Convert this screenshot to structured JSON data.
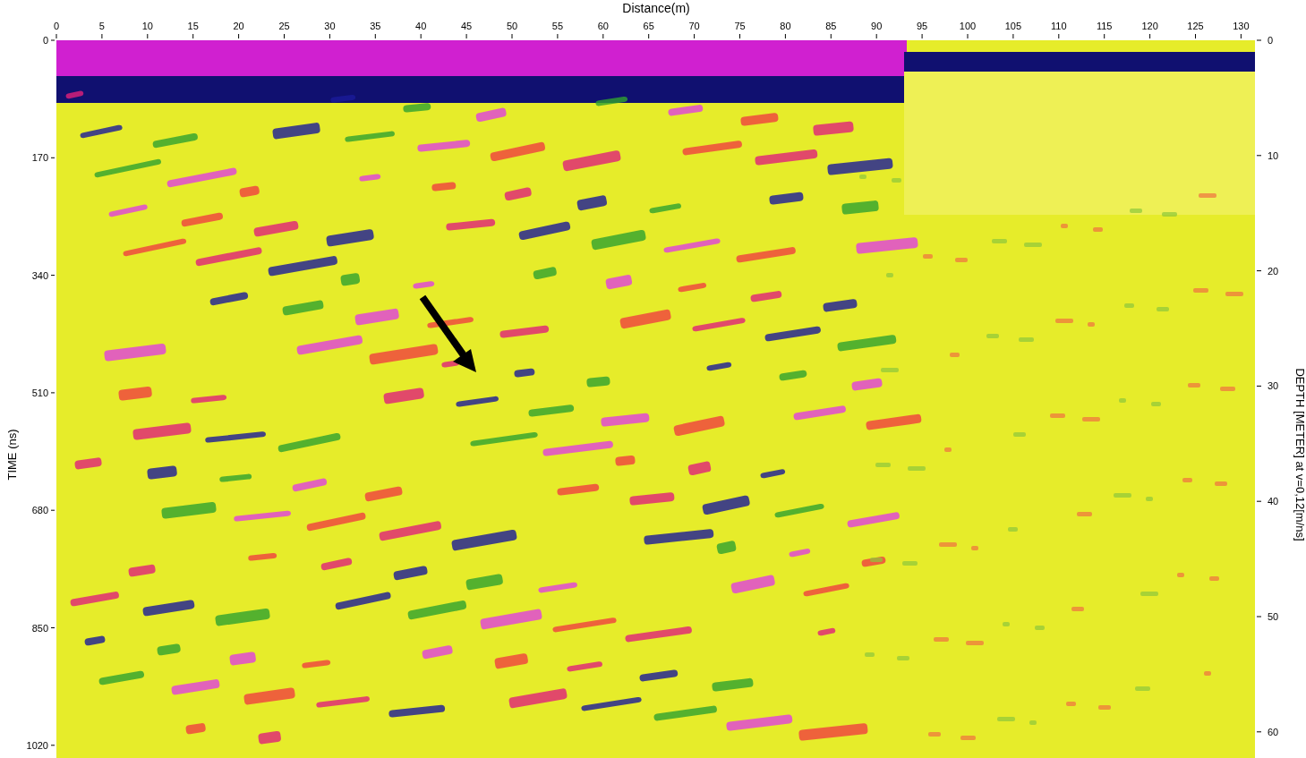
{
  "x_axis": {
    "label": "Distance(m)",
    "ticks": [
      "0",
      "5",
      "10",
      "15",
      "20",
      "25",
      "30",
      "35",
      "40",
      "45",
      "50",
      "55",
      "60",
      "65",
      "70",
      "75",
      "80",
      "85",
      "90",
      "95",
      "100",
      "105",
      "110",
      "115",
      "120",
      "125",
      "130"
    ]
  },
  "time_axis": {
    "label": "TIME (ns)",
    "ticks": [
      "0",
      "170",
      "340",
      "510",
      "680",
      "850",
      "1020"
    ]
  },
  "depth_axis": {
    "label": "DEPTH [METER] at v=0,12[m/ns]",
    "ticks": [
      "0",
      "10",
      "20",
      "30",
      "40",
      "50",
      "60"
    ]
  }
}
